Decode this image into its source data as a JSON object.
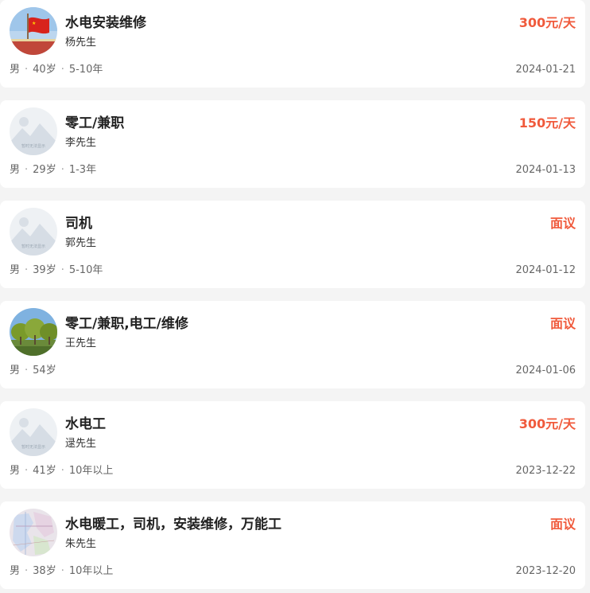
{
  "colors": {
    "salary": "#f05a3c",
    "card_bg": "#ffffff",
    "page_bg": "#f4f4f4"
  },
  "cards": [
    {
      "avatar": "flag-photo",
      "title": "水电安装维修",
      "name": "杨先生",
      "salary": "300元/天",
      "gender": "男",
      "age": "40岁",
      "experience": "5-10年",
      "date": "2024-01-21"
    },
    {
      "avatar": "placeholder-mountain",
      "avatar_caption": "暂时无法显示",
      "title": "零工/兼职",
      "name": "李先生",
      "salary": "150元/天",
      "gender": "男",
      "age": "29岁",
      "experience": "1-3年",
      "date": "2024-01-13"
    },
    {
      "avatar": "placeholder-mountain",
      "avatar_caption": "暂时无法显示",
      "title": "司机",
      "name": "郭先生",
      "salary": "面议",
      "gender": "男",
      "age": "39岁",
      "experience": "5-10年",
      "date": "2024-01-12"
    },
    {
      "avatar": "trees-photo",
      "title": "零工/兼职,电工/维修",
      "name": "王先生",
      "salary": "面议",
      "gender": "男",
      "age": "54岁",
      "experience": "",
      "date": "2024-01-06"
    },
    {
      "avatar": "placeholder-mountain",
      "avatar_caption": "暂时无法显示",
      "title": "水电工",
      "name": "逯先生",
      "salary": "300元/天",
      "gender": "男",
      "age": "41岁",
      "experience": "10年以上",
      "date": "2023-12-22"
    },
    {
      "avatar": "map-photo",
      "title": "水电暖工，司机，安装维修，万能工",
      "name": "朱先生",
      "salary": "面议",
      "gender": "男",
      "age": "38岁",
      "experience": "10年以上",
      "date": "2023-12-20"
    }
  ]
}
